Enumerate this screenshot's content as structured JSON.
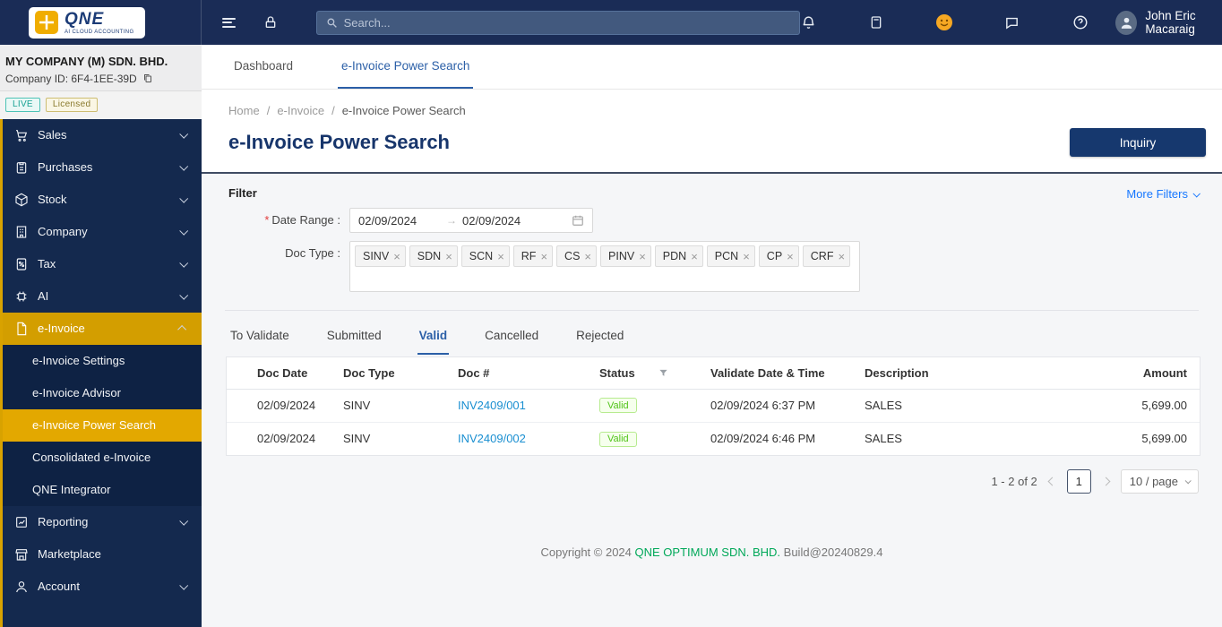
{
  "topbar": {
    "logo_title": "QNE",
    "logo_subtitle": "AI CLOUD ACCOUNTING",
    "search_placeholder": "Search...",
    "user_name": "John Eric Macaraig"
  },
  "glyphs": {
    "close": "×",
    "arrow_right": "→",
    "slash": "/",
    "asterisk": "*",
    "question": "?"
  },
  "sidebar": {
    "company_name": "MY COMPANY (M) SDN. BHD.",
    "company_id": "Company ID: 6F4-1EE-39D",
    "live_badge": "LIVE",
    "licensed_badge": "Licensed",
    "items": [
      {
        "label": "Sales"
      },
      {
        "label": "Purchases"
      },
      {
        "label": "Stock"
      },
      {
        "label": "Company"
      },
      {
        "label": "Tax"
      },
      {
        "label": "AI"
      },
      {
        "label": "e-Invoice"
      },
      {
        "label": "Reporting"
      },
      {
        "label": "Marketplace"
      },
      {
        "label": "Account"
      }
    ],
    "einvoice_submenu": [
      {
        "label": "e-Invoice Settings"
      },
      {
        "label": "e-Invoice Advisor"
      },
      {
        "label": "e-Invoice Power Search"
      },
      {
        "label": "Consolidated e-Invoice"
      },
      {
        "label": "QNE Integrator"
      }
    ]
  },
  "page_tabs": [
    {
      "label": "Dashboard"
    },
    {
      "label": "e-Invoice Power Search"
    }
  ],
  "breadcrumb": [
    {
      "label": "Home"
    },
    {
      "label": "e-Invoice"
    },
    {
      "label": "e-Invoice Power Search"
    }
  ],
  "page": {
    "title": "e-Invoice Power Search",
    "inquiry_button": "Inquiry"
  },
  "filter": {
    "title": "Filter",
    "more_filters": "More Filters",
    "date_range_label": "Date Range :",
    "date_from": "02/09/2024",
    "date_to": "02/09/2024",
    "doc_type_label": "Doc Type :",
    "doc_types": [
      "SINV",
      "SDN",
      "SCN",
      "RF",
      "CS",
      "PINV",
      "PDN",
      "PCN",
      "CP",
      "CRF"
    ]
  },
  "status_tabs": [
    {
      "label": "To Validate"
    },
    {
      "label": "Submitted"
    },
    {
      "label": "Valid"
    },
    {
      "label": "Cancelled"
    },
    {
      "label": "Rejected"
    }
  ],
  "table": {
    "columns": [
      "Doc Date",
      "Doc Type",
      "Doc #",
      "Status",
      "Validate Date & Time",
      "Description",
      "Amount"
    ],
    "rows": [
      {
        "doc_date": "02/09/2024",
        "doc_type": "SINV",
        "doc_no": "INV2409/001",
        "status": "Valid",
        "validate_datetime": "02/09/2024 6:37 PM",
        "description": "SALES",
        "amount": "5,699.00"
      },
      {
        "doc_date": "02/09/2024",
        "doc_type": "SINV",
        "doc_no": "INV2409/002",
        "status": "Valid",
        "validate_datetime": "02/09/2024 6:46 PM",
        "description": "SALES",
        "amount": "5,699.00"
      }
    ]
  },
  "pagination": {
    "range_text": "1 - 2 of 2",
    "current_page": "1",
    "page_size": "10 / page"
  },
  "footer": {
    "prefix": "Copyright © 2024",
    "company": "QNE OPTIMUM SDN. BHD.",
    "suffix": "Build@20240829.4"
  }
}
